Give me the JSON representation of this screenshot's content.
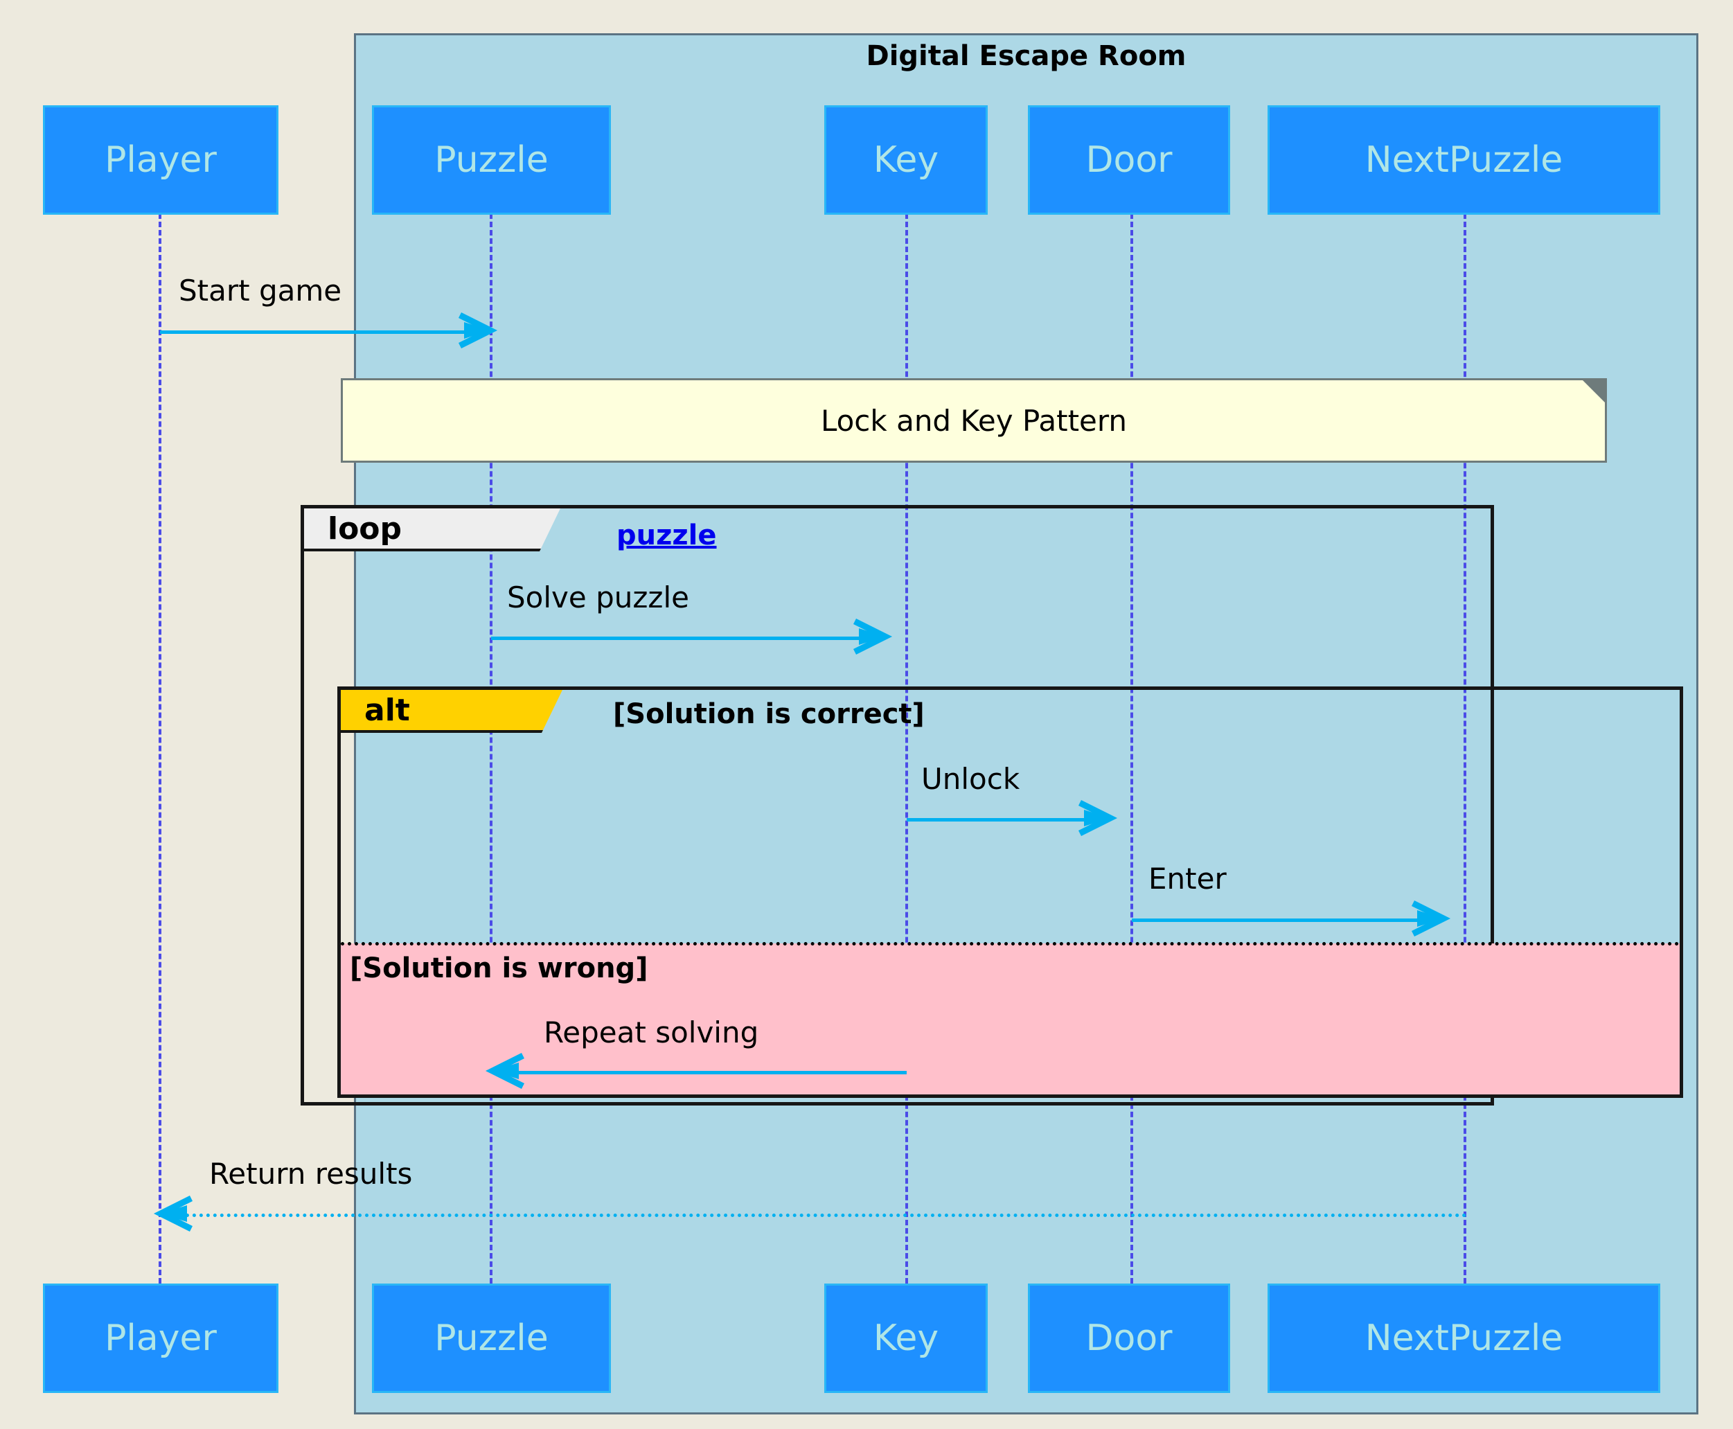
{
  "diagram": {
    "type": "sequence-diagram",
    "background_color": "#EDEADE",
    "group_box": {
      "title": "Digital Escape Room",
      "fill_color": "#ADD8E6",
      "border_color": "#5B7383"
    },
    "participant_style": {
      "fill_color": "#1E90FF",
      "border_color": "#29B6F6",
      "text_color": "#B0E6E6"
    },
    "lifeline_color": "#4B4BE8",
    "arrow_color": "#00B0F0"
  },
  "participants": [
    {
      "name": "Player",
      "in_group": false
    },
    {
      "name": "Puzzle",
      "in_group": true
    },
    {
      "name": "Key",
      "in_group": true
    },
    {
      "name": "Door",
      "in_group": true
    },
    {
      "name": "NextPuzzle",
      "in_group": true
    }
  ],
  "participants_bottom": [
    {
      "name": "Player"
    },
    {
      "name": "Puzzle"
    },
    {
      "name": "Key"
    },
    {
      "name": "Door"
    },
    {
      "name": "NextPuzzle"
    }
  ],
  "note": {
    "text": "Lock and Key Pattern",
    "fill_color": "#FEFFDD",
    "border_color": "#6E7B7B"
  },
  "fragments": {
    "loop": {
      "keyword": "loop",
      "label": "puzzle",
      "tab_color": "#EEEEEE",
      "label_is_link": true,
      "label_color": "#0000EE"
    },
    "alt": {
      "keyword": "alt",
      "tab_color": "#FFD100",
      "branches": [
        {
          "condition": "[Solution is correct]",
          "fill_color": "transparent"
        },
        {
          "condition": "[Solution is wrong]",
          "fill_color": "#FFC0CB"
        }
      ]
    }
  },
  "messages": [
    {
      "label": "Start game",
      "from": "Player",
      "to": "Puzzle",
      "style": "solid",
      "direction": "right"
    },
    {
      "label": "Solve puzzle",
      "from": "Puzzle",
      "to": "Key",
      "style": "solid",
      "direction": "right"
    },
    {
      "label": "Unlock",
      "from": "Key",
      "to": "Door",
      "style": "solid",
      "direction": "right"
    },
    {
      "label": "Enter",
      "from": "Door",
      "to": "NextPuzzle",
      "style": "solid",
      "direction": "right"
    },
    {
      "label": "Repeat solving",
      "from": "Key",
      "to": "Puzzle",
      "style": "solid",
      "direction": "left"
    },
    {
      "label": "Return results",
      "from": "NextPuzzle",
      "to": "Player",
      "style": "dotted",
      "direction": "left"
    }
  ]
}
